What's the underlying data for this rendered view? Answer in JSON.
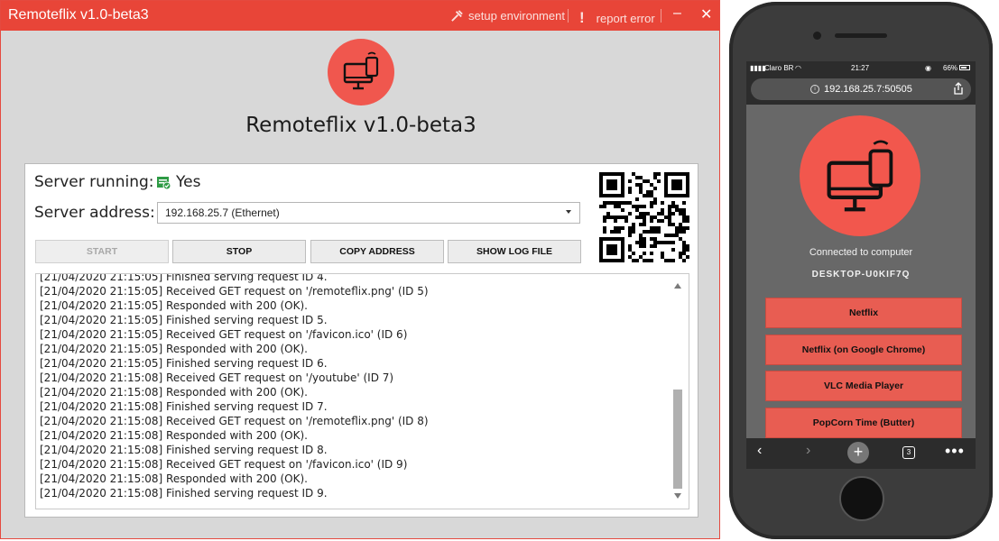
{
  "window": {
    "title": "Remoteflix v1.0-beta3",
    "setup_label": "setup environment",
    "report_label": "report error",
    "minimize_glyph": "–",
    "close_glyph": "✕"
  },
  "app": {
    "name": "Remoteflix v1.0-beta3",
    "server_running_label": "Server running:",
    "server_running_value": "Yes",
    "server_address_label": "Server address:",
    "server_address_value": "192.168.25.7 (Ethernet)",
    "buttons": {
      "start": "START",
      "stop": "STOP",
      "copy": "COPY ADDRESS",
      "log": "SHOW LOG FILE"
    },
    "log_lines": [
      "[21/04/2020 21:15:05] Finished serving request ID 4.",
      "[21/04/2020 21:15:05] Received GET request on '/remoteflix.png' (ID 5)",
      "[21/04/2020 21:15:05] Responded with 200 (OK).",
      "[21/04/2020 21:15:05] Finished serving request ID 5.",
      "[21/04/2020 21:15:05] Received GET request on '/favicon.ico' (ID 6)",
      "[21/04/2020 21:15:05] Responded with 200 (OK).",
      "[21/04/2020 21:15:05] Finished serving request ID 6.",
      "[21/04/2020 21:15:08] Received GET request on '/youtube' (ID 7)",
      "[21/04/2020 21:15:08] Responded with 200 (OK).",
      "[21/04/2020 21:15:08] Finished serving request ID 7.",
      "[21/04/2020 21:15:08] Received GET request on '/remoteflix.png' (ID 8)",
      "[21/04/2020 21:15:08] Responded with 200 (OK).",
      "[21/04/2020 21:15:08] Finished serving request ID 8.",
      "[21/04/2020 21:15:08] Received GET request on '/favicon.ico' (ID 9)",
      "[21/04/2020 21:15:08] Responded with 200 (OK).",
      "[21/04/2020 21:15:08] Finished serving request ID 9."
    ]
  },
  "phone": {
    "carrier": "Claro BR",
    "time": "21:27",
    "battery": "66%",
    "url": "192.168.25.7:50505",
    "connected_text": "Connected to computer",
    "computer_name": "DESKTOP-U0KIF7Q",
    "buttons": [
      "Netflix",
      "Netflix (on Google Chrome)",
      "VLC Media Player",
      "PopCorn Time (Butter)"
    ],
    "tab_count": "3"
  },
  "colors": {
    "accent": "#e84538",
    "logo": "#f0574e",
    "status_ok": "#2e9b45"
  },
  "icons": [
    "tools-icon",
    "exclamation-icon",
    "computer-phone-icon",
    "shield-check-icon",
    "qr-code-icon",
    "chevron-left-icon",
    "chevron-right-icon",
    "plus-icon",
    "tabs-icon",
    "more-icon",
    "share-icon",
    "info-icon",
    "wifi-icon",
    "battery-icon"
  ]
}
